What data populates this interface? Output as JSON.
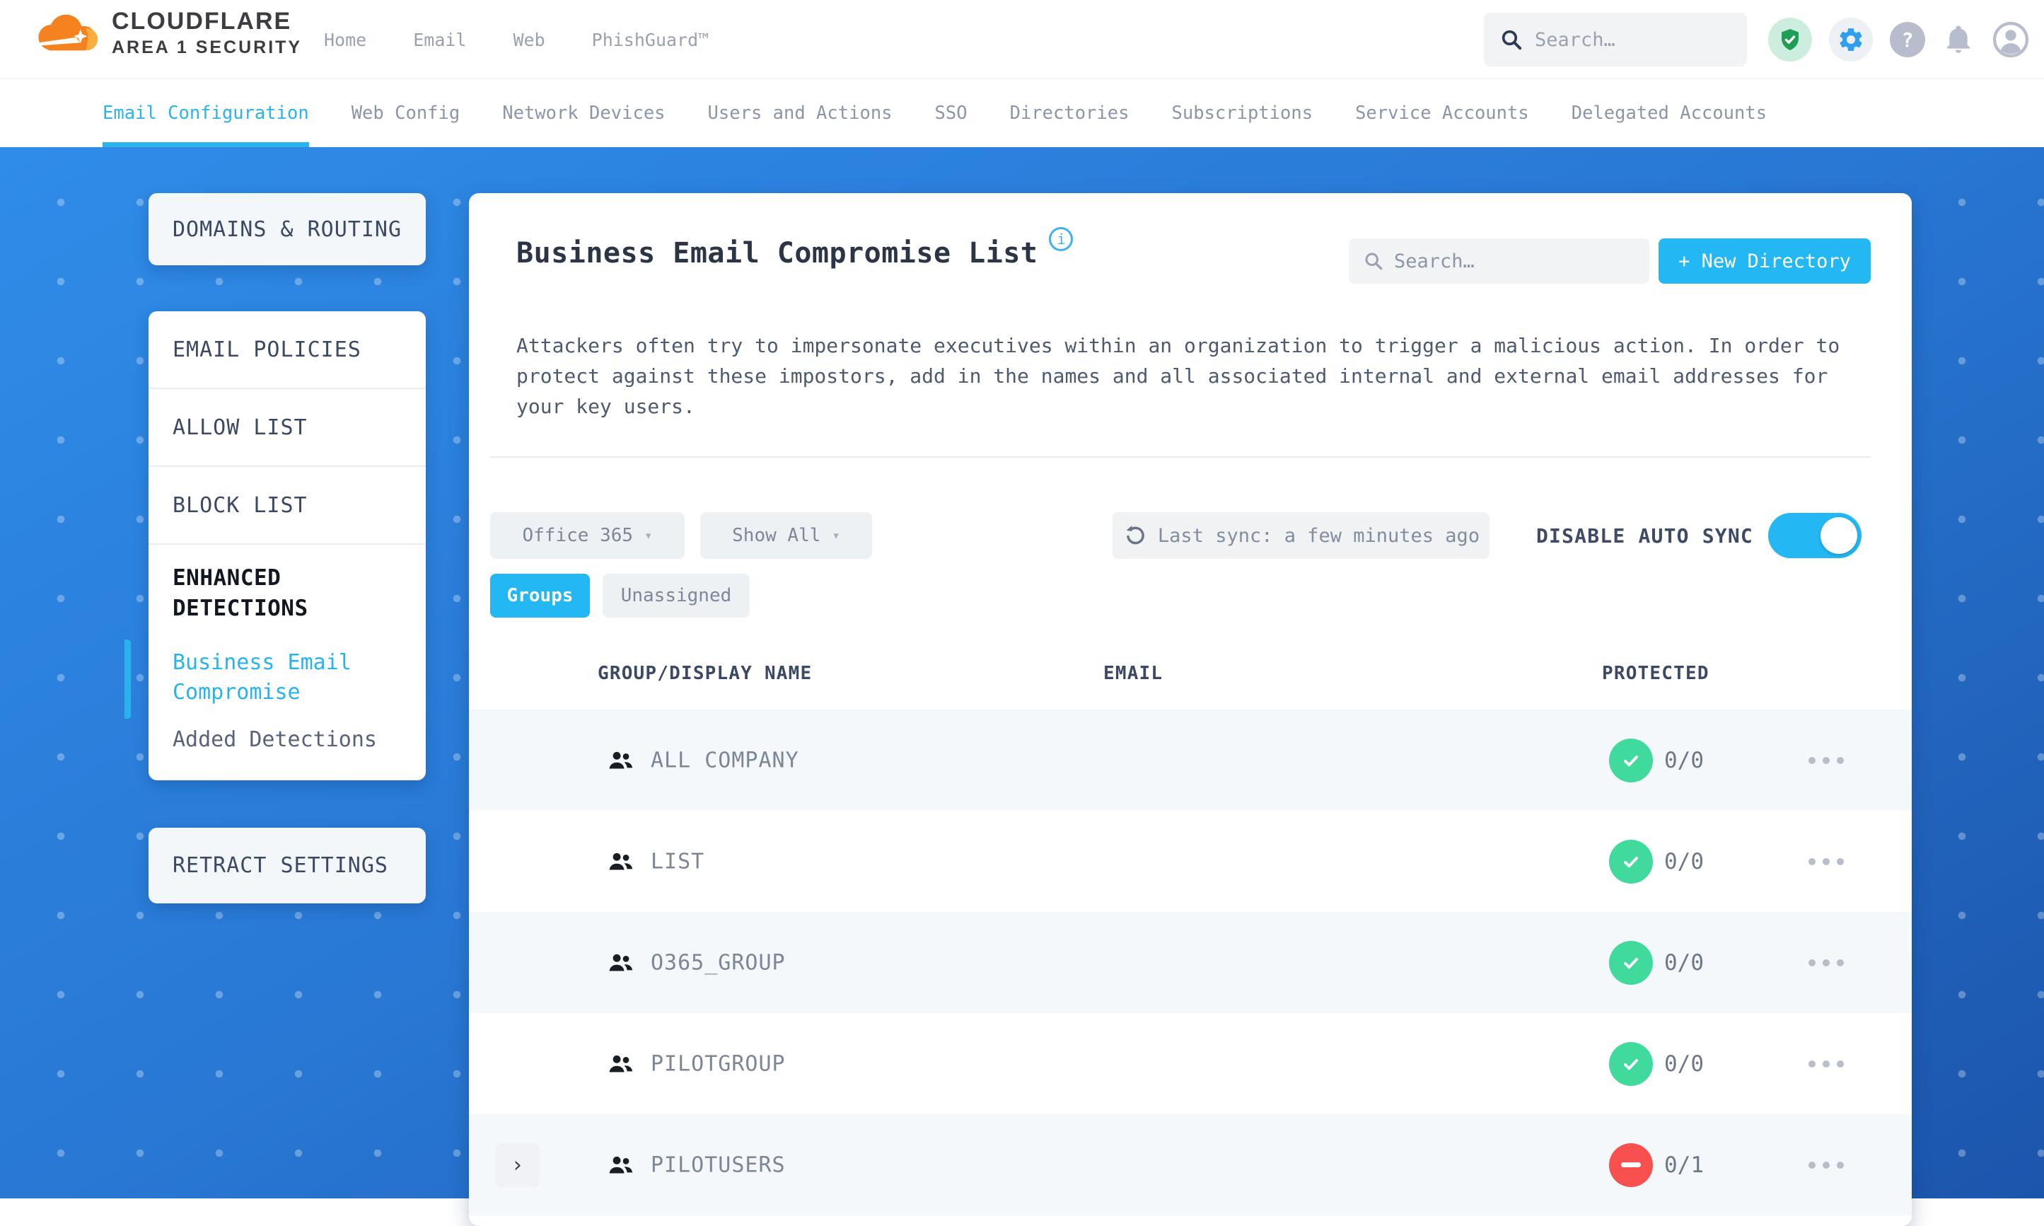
{
  "header": {
    "brand": {
      "title": "CLOUDFLARE",
      "subtitle": "AREA 1 SECURITY"
    },
    "nav": [
      "Home",
      "Email",
      "Web",
      "PhishGuard™"
    ],
    "search_placeholder": "Search…"
  },
  "subnav": {
    "items": [
      {
        "label": "Email Configuration",
        "active": true
      },
      {
        "label": "Web Config",
        "active": false
      },
      {
        "label": "Network Devices",
        "active": false
      },
      {
        "label": "Users and Actions",
        "active": false
      },
      {
        "label": "SSO",
        "active": false
      },
      {
        "label": "Directories",
        "active": false
      },
      {
        "label": "Subscriptions",
        "active": false
      },
      {
        "label": "Service Accounts",
        "active": false
      },
      {
        "label": "Delegated Accounts",
        "active": false
      }
    ]
  },
  "sidebar": {
    "domains_routing": "DOMAINS & ROUTING",
    "email_policies": "EMAIL POLICIES",
    "allow_list": "ALLOW LIST",
    "block_list": "BLOCK LIST",
    "enhanced_detections": "ENHANCED DETECTIONS",
    "business_email_compromise": "Business Email Compromise",
    "added_detections": "Added Detections",
    "retract_settings": "RETRACT SETTINGS"
  },
  "main": {
    "title": "Business Email Compromise List",
    "search_placeholder": "Search…",
    "new_directory_button": "+ New Directory",
    "description": "Attackers often try to impersonate executives within an organization to trigger a malicious action. In order to protect against these impostors, add in the names and all associated internal and external email addresses for your key users.",
    "filters": {
      "directory": "Office 365",
      "show": "Show All"
    },
    "sync": {
      "last_sync": "Last sync: a few minutes ago",
      "toggle_label": "DISABLE AUTO SYNC",
      "auto_sync_enabled": true
    },
    "tabs": [
      {
        "label": "Groups",
        "active": true
      },
      {
        "label": "Unassigned",
        "active": false
      }
    ],
    "table": {
      "columns": [
        "GROUP/DISPLAY NAME",
        "EMAIL",
        "PROTECTED"
      ],
      "rows": [
        {
          "name": "ALL COMPANY",
          "email": "",
          "protected": "0/0",
          "status": "ok",
          "expandable": false
        },
        {
          "name": "LIST",
          "email": "",
          "protected": "0/0",
          "status": "ok",
          "expandable": false
        },
        {
          "name": "O365_GROUP",
          "email": "",
          "protected": "0/0",
          "status": "ok",
          "expandable": false
        },
        {
          "name": "PILOTGROUP",
          "email": "",
          "protected": "0/0",
          "status": "ok",
          "expandable": false
        },
        {
          "name": "PILOTUSERS",
          "email": "",
          "protected": "0/1",
          "status": "blocked",
          "expandable": true
        }
      ]
    }
  },
  "glyphs": {
    "caret": "▾",
    "chevron": "›",
    "help": "?",
    "info": "i"
  },
  "colors": {
    "accent_cyan": "#23b7f3",
    "blue_bg_top": "#2f8ce8",
    "blue_bg_bottom": "#1c55ac",
    "ok_green": "#40da9d",
    "blocked_red": "#f8504f"
  }
}
